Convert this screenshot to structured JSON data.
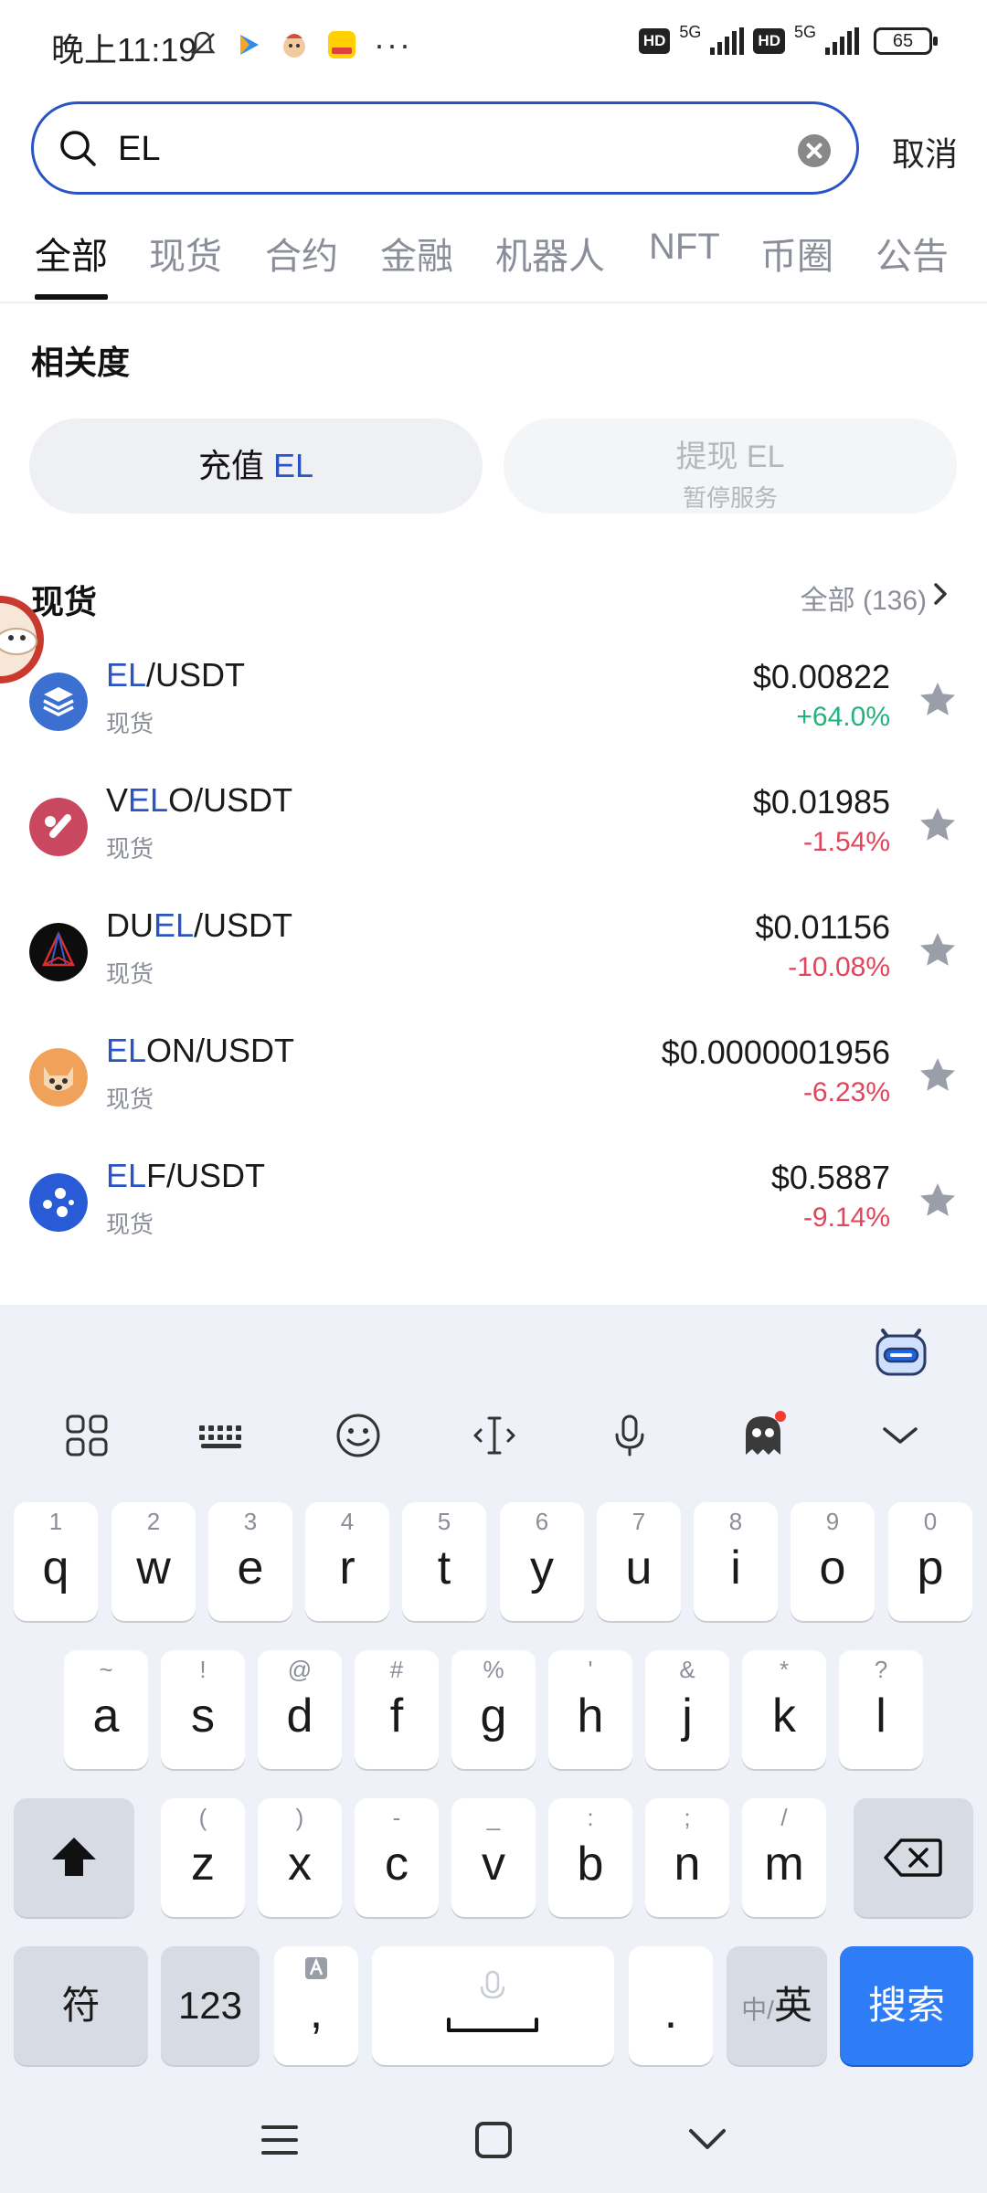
{
  "status_bar": {
    "time": "晚上11:19",
    "more": "···",
    "hd": "HD",
    "net1": "5G",
    "net2": "5G",
    "battery": "65"
  },
  "search": {
    "value": "EL",
    "cancel_label": "取消"
  },
  "tabs": [
    "全部",
    "现货",
    "合约",
    "金融",
    "机器人",
    "NFT",
    "币圈",
    "公告"
  ],
  "relevance": {
    "title": "相关度",
    "deposit_prefix": "充值 ",
    "deposit_token": "EL",
    "withdraw_label": "提现 EL",
    "withdraw_status": "暂停服务"
  },
  "spot": {
    "title": "现货",
    "all_label": "全部 (136)",
    "items": [
      {
        "pre": "",
        "hl": "EL",
        "post": "/USDT",
        "sub": "现货",
        "price": "$0.00822",
        "change": "+64.0%",
        "dir": "up",
        "icon": "layers-coin-icon",
        "color": "#3b6fd0"
      },
      {
        "pre": "V",
        "hl": "EL",
        "post": "O/USDT",
        "sub": "现货",
        "price": "$0.01985",
        "change": "-1.54%",
        "dir": "down",
        "icon": "velo-coin-icon",
        "color": "#c9485f"
      },
      {
        "pre": "DU",
        "hl": "EL",
        "post": "/USDT",
        "sub": "现货",
        "price": "$0.01156",
        "change": "-10.08%",
        "dir": "down",
        "icon": "duel-coin-icon",
        "color": "#111111"
      },
      {
        "pre": "",
        "hl": "EL",
        "post": "ON/USDT",
        "sub": "现货",
        "price": "$0.0000001956",
        "change": "-6.23%",
        "dir": "down",
        "icon": "dog-coin-icon",
        "color": "#f0a25a"
      },
      {
        "pre": "",
        "hl": "EL",
        "post": "F/USDT",
        "sub": "现货",
        "price": "$0.5887",
        "change": "-9.14%",
        "dir": "down",
        "icon": "elf-coin-icon",
        "color": "#2a5bd6"
      }
    ]
  },
  "keyboard": {
    "row1": [
      {
        "hint": "1",
        "ch": "q"
      },
      {
        "hint": "2",
        "ch": "w"
      },
      {
        "hint": "3",
        "ch": "e"
      },
      {
        "hint": "4",
        "ch": "r"
      },
      {
        "hint": "5",
        "ch": "t"
      },
      {
        "hint": "6",
        "ch": "y"
      },
      {
        "hint": "7",
        "ch": "u"
      },
      {
        "hint": "8",
        "ch": "i"
      },
      {
        "hint": "9",
        "ch": "o"
      },
      {
        "hint": "0",
        "ch": "p"
      }
    ],
    "row2": [
      {
        "hint": "~",
        "ch": "a"
      },
      {
        "hint": "!",
        "ch": "s"
      },
      {
        "hint": "@",
        "ch": "d"
      },
      {
        "hint": "#",
        "ch": "f"
      },
      {
        "hint": "%",
        "ch": "g"
      },
      {
        "hint": "'",
        "ch": "h"
      },
      {
        "hint": "&",
        "ch": "j"
      },
      {
        "hint": "*",
        "ch": "k"
      },
      {
        "hint": "?",
        "ch": "l"
      }
    ],
    "row3": [
      {
        "hint": "(",
        "ch": "z"
      },
      {
        "hint": ")",
        "ch": "x"
      },
      {
        "hint": "-",
        "ch": "c"
      },
      {
        "hint": "_",
        "ch": "v"
      },
      {
        "hint": ":",
        "ch": "b"
      },
      {
        "hint": ";",
        "ch": "n"
      },
      {
        "hint": "/",
        "ch": "m"
      }
    ],
    "symbols_label": "符",
    "numbers_label": "123",
    "comma_label": ",",
    "period_label": ".",
    "lang_dim": "中/",
    "lang_active": "英",
    "search_label": "搜索"
  },
  "colors": {
    "accent": "#2a54c4",
    "up": "#23b27a",
    "down": "#e0455b",
    "keyboard_action": "#2e7cf6"
  }
}
